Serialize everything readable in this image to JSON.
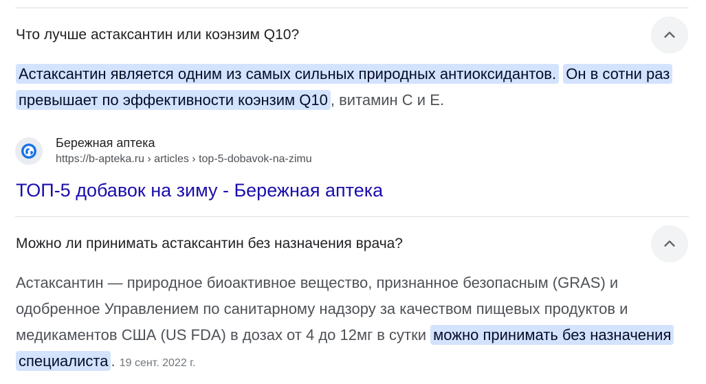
{
  "faq": [
    {
      "question": "Что лучше астаксантин или коэнзим Q10?",
      "toggle_icon": "chevron-up-icon",
      "answer": {
        "highlight_1": "Астаксантин является одним из самых сильных природных антиоксидантов.",
        "highlight_2": "Он в сотни раз превышает по эффективности коэнзим Q10",
        "tail": ", витамин С и Е."
      },
      "source": {
        "favicon_icon": "globe-icon",
        "site_name": "Бережная аптека",
        "url": "https://b-apteka.ru › articles › top-5-dobavok-na-zimu",
        "title": "ТОП-5 добавок на зиму - Бережная аптека"
      }
    },
    {
      "question": "Можно ли принимать астаксантин без назначения врача?",
      "toggle_icon": "chevron-up-icon",
      "answer": {
        "plain": "Астаксантин — природное биоактивное вещество, признанное безопасным (GRAS) и одобренное Управлением по санитарному надзору за качеством пищевых продуктов и медикаментов США (US FDA) в дозах от 4 до 12мг в сутки ",
        "highlight": "можно принимать без назначения специалиста",
        "tail": ". ",
        "date": "19 сент. 2022 г."
      }
    }
  ],
  "colors": {
    "highlight_bg": "#d3e3fd",
    "link": "#1a0dab",
    "divider": "#dadce0",
    "toggle_bg": "#f1f3f4"
  }
}
